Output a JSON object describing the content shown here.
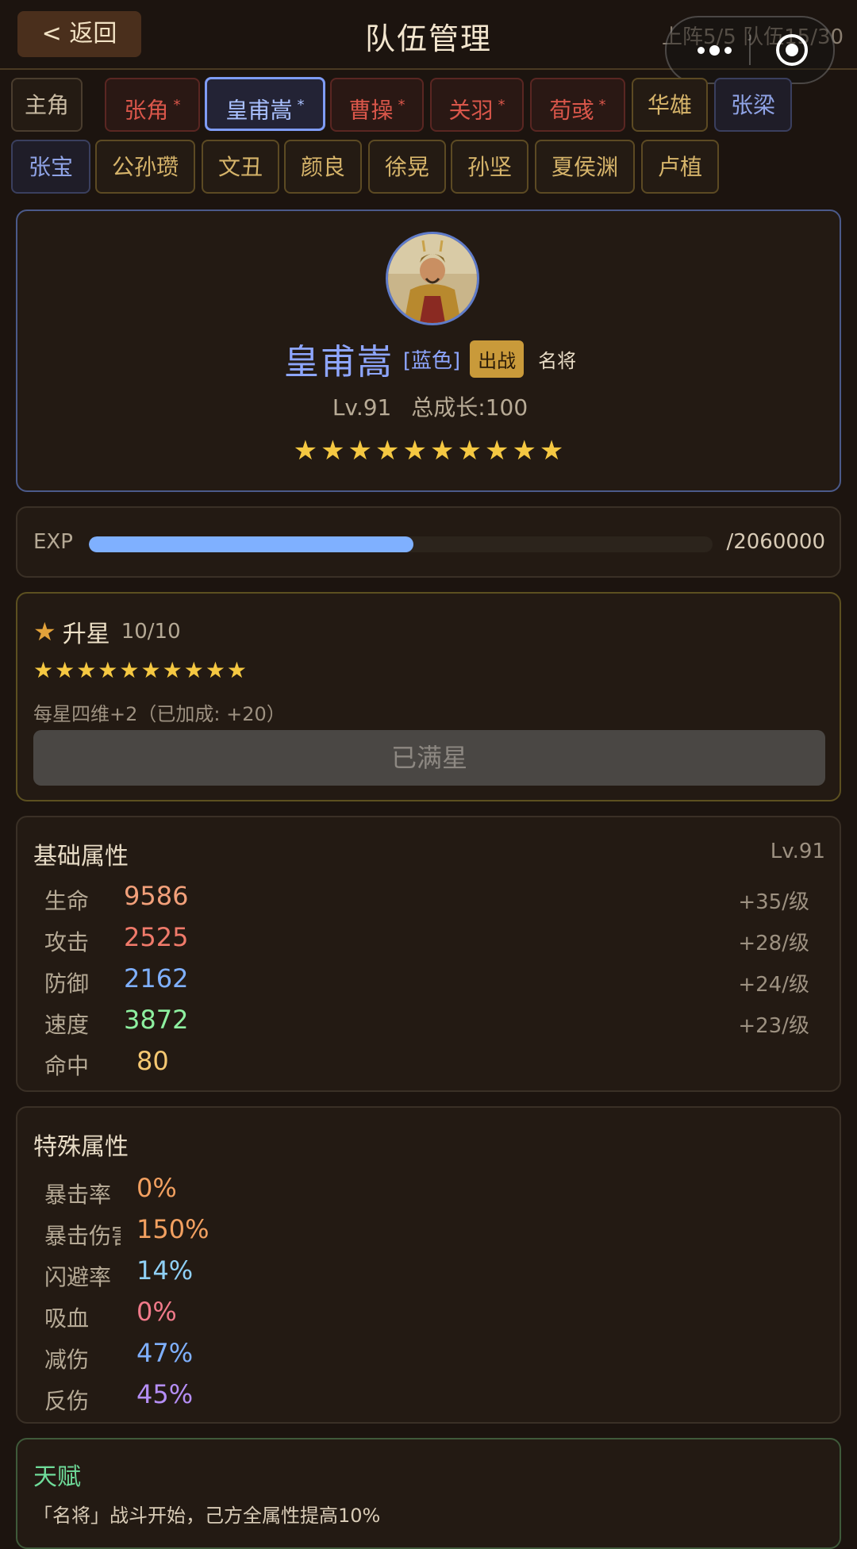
{
  "header": {
    "back_label": "< 返回",
    "title": "队伍管理",
    "team_info": "上阵5/5 队伍15/30"
  },
  "hero_tabs": [
    {
      "label": "主角",
      "marked": false
    },
    {
      "label": "张角",
      "marked": true
    },
    {
      "label": "皇甫嵩",
      "marked": true,
      "selected": true
    },
    {
      "label": "曹操",
      "marked": true
    },
    {
      "label": "关羽",
      "marked": true
    },
    {
      "label": "荀彧",
      "marked": true
    },
    {
      "label": "华雄",
      "marked": false
    },
    {
      "label": "张梁",
      "marked": false
    },
    {
      "label": "张宝",
      "marked": false
    },
    {
      "label": "公孙瓒",
      "marked": false
    },
    {
      "label": "文丑",
      "marked": false
    },
    {
      "label": "颜良",
      "marked": false
    },
    {
      "label": "徐晃",
      "marked": false
    },
    {
      "label": "孙坚",
      "marked": false
    },
    {
      "label": "夏侯渊",
      "marked": false
    },
    {
      "label": "卢植",
      "marked": false
    }
  ],
  "hero": {
    "name": "皇甫嵩",
    "quality": "[蓝色]",
    "deploy_badge": "出战",
    "tag": "名将",
    "level": "Lv.91",
    "growth": "总成长:100",
    "stars": "★★★★★★★★★★",
    "colors": {
      "name": "#8ea6ff",
      "star": "#f5c842"
    }
  },
  "exp": {
    "label": "EXP",
    "text": "/2060000",
    "progress": 0.52,
    "color": "#7fb0ff"
  },
  "star_up": {
    "title": "升星",
    "count": "10/10",
    "stars": "★★★★★★★★★★",
    "note": "每星四维+2（已加成: +20）",
    "button_label": "已满星"
  },
  "base_attrs": {
    "title": "基础属性",
    "level": "Lv.91",
    "rows": [
      {
        "name": "生命",
        "value": "9586",
        "growth": "+35/级",
        "color": "#f2a07a"
      },
      {
        "name": "攻击",
        "value": "2525",
        "growth": "+28/级",
        "color": "#f07a6a"
      },
      {
        "name": "防御",
        "value": "2162",
        "growth": "+24/级",
        "color": "#7fb0ff"
      },
      {
        "name": "速度",
        "value": "3872",
        "growth": "+23/级",
        "color": "#8ef0a0"
      },
      {
        "name": "命中",
        "value": "80",
        "growth": "",
        "color": "#f5c872"
      }
    ]
  },
  "special_attrs": {
    "title": "特殊属性",
    "rows": [
      {
        "name": "暴击率",
        "value": "0%",
        "color": "#f2a060"
      },
      {
        "name": "暴击伤害",
        "value": "150%",
        "color": "#f2a060"
      },
      {
        "name": "闪避率",
        "value": "14%",
        "color": "#8fd0f5"
      },
      {
        "name": "吸血",
        "value": "0%",
        "color": "#f07a8a"
      },
      {
        "name": "减伤",
        "value": "47%",
        "color": "#7fb0ff"
      },
      {
        "name": "反伤",
        "value": "45%",
        "color": "#b58ef5"
      }
    ]
  },
  "talent": {
    "title": "天赋",
    "text": "「名将」战斗开始，己方全属性提高10%"
  }
}
